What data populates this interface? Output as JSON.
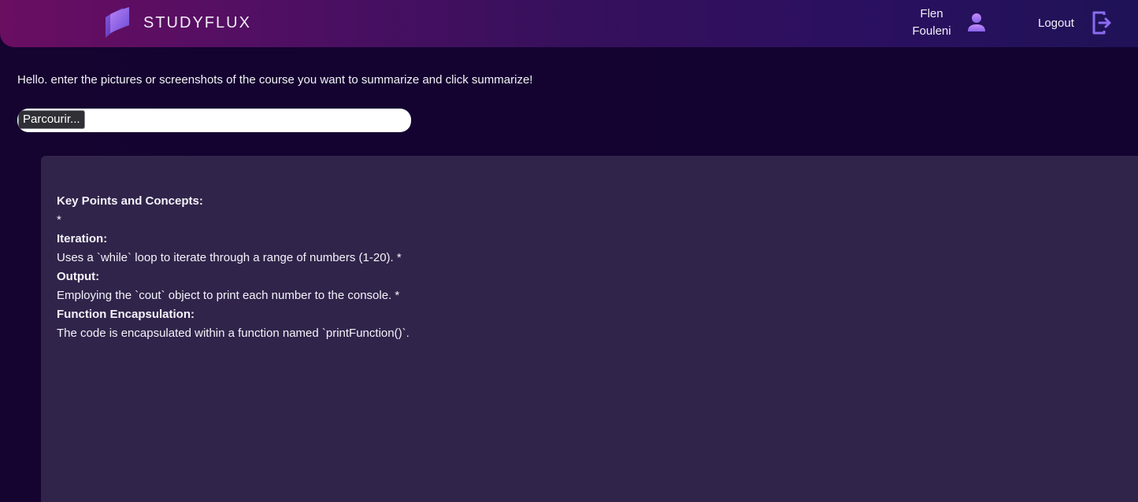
{
  "header": {
    "brand": "STUDYFLUX",
    "user": {
      "first_name": "Flen",
      "last_name": "Fouleni"
    },
    "logout_label": "Logout"
  },
  "main": {
    "intro_text": "Hello. enter the pictures or screenshots of the course you want to summarize and click summarize!",
    "file_input": {
      "browse_label": "Parcourir..."
    },
    "summary": {
      "lines": [
        "Key Points and Concepts:",
        "*",
        "Iteration:",
        "Uses a `while` loop to iterate through a range of numbers (1-20). *",
        "Output:",
        "Employing the `cout` object to print each number to the console. *",
        "Function Encapsulation:",
        "The code is encapsulated within a function named `printFunction()`."
      ]
    }
  },
  "colors": {
    "background": "#13042e",
    "panel": "#30244a",
    "accent_icon": "#8b6cf0",
    "header_gradient_start": "#6a0e62",
    "header_gradient_end": "#1f1257"
  },
  "icons": {
    "logo": "studyflux-logo-icon",
    "user": "user-icon",
    "logout": "logout-icon"
  }
}
